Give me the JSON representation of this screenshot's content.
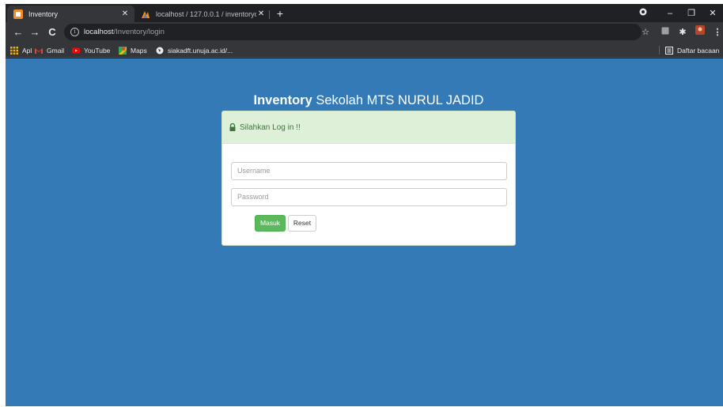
{
  "browser": {
    "tabs": [
      {
        "title": "Inventory",
        "active": true
      },
      {
        "title": "localhost / 127.0.0.1 / inventoryo",
        "active": false
      }
    ],
    "url": {
      "host": "localhost",
      "path": "/Inventory/login"
    },
    "bookmarks": [
      "Apl",
      "Gmail",
      "YouTube",
      "Maps",
      "siakadft.unuja.ac.id/..."
    ],
    "reading_list": "Daftar bacaan",
    "icons": {
      "back": "←",
      "forward": "→",
      "reload": "C",
      "info": "i",
      "close": "✕",
      "new_tab": "+",
      "minimize": "–",
      "restore": "❐",
      "window_close": "✕",
      "star": "☆",
      "puzzle": "✱",
      "menu": "⋮"
    }
  },
  "page": {
    "heading_bold": "Inventory",
    "heading_rest": " Sekolah MTS NURUL JADID",
    "panel_title": "Silahkan Log in !!",
    "username_placeholder": "Username",
    "password_placeholder": "Password",
    "submit_label": "Masuk",
    "reset_label": "Reset"
  },
  "colors": {
    "page_background": "#337ab7",
    "panel_header": "#dff0d8",
    "panel_header_text": "#3c763d",
    "primary_button": "#5cb85c"
  }
}
